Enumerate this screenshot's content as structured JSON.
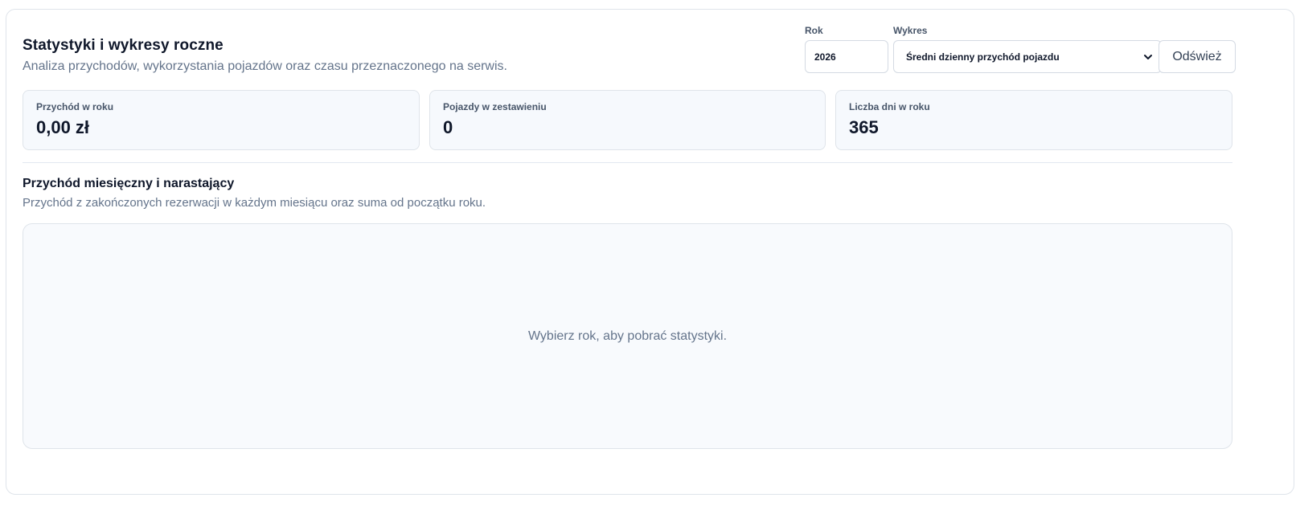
{
  "header": {
    "title": "Statystyki i wykresy roczne",
    "subtitle": "Analiza przychodów, wykorzystania pojazdów oraz czasu przeznaczonego na serwis."
  },
  "controls": {
    "year_label": "Rok",
    "year_value": "2026",
    "chart_label": "Wykres",
    "chart_selected": "Średni dzienny przychód pojazdu",
    "refresh_label": "Odśwież"
  },
  "stats": [
    {
      "label": "Przychód w roku",
      "value": "0,00 zł"
    },
    {
      "label": "Pojazdy w zestawieniu",
      "value": "0"
    },
    {
      "label": "Liczba dni w roku",
      "value": "365"
    }
  ],
  "section": {
    "title": "Przychód miesięczny i narastający",
    "subtitle": "Przychód z zakończonych rezerwacji w każdym miesiącu oraz suma od początku roku.",
    "empty_message": "Wybierz rok, aby pobrać statystyki."
  },
  "icons": {
    "select_chevron": "chevron-down-icon"
  }
}
